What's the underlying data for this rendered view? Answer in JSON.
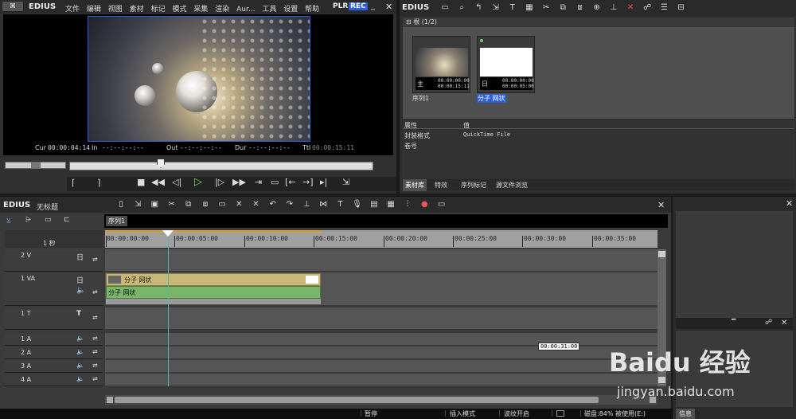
{
  "player": {
    "brand": "EDIUS",
    "menu": [
      "文件",
      "编辑",
      "视图",
      "素材",
      "标记",
      "模式",
      "采集",
      "渲染",
      "Aur...",
      "工具",
      "设置",
      "帮助"
    ],
    "mode_plr": "PLR",
    "mode_rec": "REC",
    "cur_label": "Cur",
    "cur_value": "00:00:04:14",
    "in_label": "In",
    "in_value": "--:--:--:--",
    "out_label": "Out",
    "out_value": "--:--:--:--",
    "dur_label": "Dur",
    "dur_value": "--:--:--:--",
    "ttl_label": "Ttl",
    "ttl_value": "00:00:15:11"
  },
  "bin": {
    "brand": "EDIUS",
    "folder_label": "根 (1/2)",
    "clips": [
      {
        "name": "序列1",
        "badge": "主",
        "tc1": "00:00:00:00",
        "tc2": "00:00:15:11"
      },
      {
        "name": "分子 网状",
        "badge": "日",
        "tc1": "00:00:00:00",
        "tc2": "00:00:05:00"
      }
    ],
    "prop_header_key": "属性",
    "prop_header_val": "值",
    "props": [
      {
        "key": "封装格式",
        "val": "QuickTime File"
      },
      {
        "key": "卷号",
        "val": ""
      }
    ],
    "tabs": [
      "素材库",
      "特效",
      "序列标记",
      "源文件浏览"
    ]
  },
  "timeline": {
    "brand": "EDIUS",
    "project_title": "无标题",
    "sequence_tab": "序列1",
    "scale_label": "1 秒",
    "ruler": [
      "00:00:00:00",
      "00:00:05:00",
      "00:00:10:00",
      "00:00:15:00",
      "00:00:20:00",
      "00:00:25:00",
      "00:00:30:00",
      "00:00:35:00"
    ],
    "tracks": [
      {
        "name": "2 V",
        "type_icon": "日"
      },
      {
        "name": "1 VA",
        "type_icon": "日"
      },
      {
        "name": "1 T",
        "type_icon": "T"
      },
      {
        "name": "1 A"
      },
      {
        "name": "2 A"
      },
      {
        "name": "3 A"
      },
      {
        "name": "4 A"
      }
    ],
    "clip_video_label": "分子 网状",
    "clip_audio_label": "分子 网状",
    "tooltip_tc": "00:00:31:00"
  },
  "status": {
    "pause": "暂停",
    "insert_mode": "插入模式",
    "ripple": "波纹开启",
    "disk": "磁盘:84% 被使用(E:)"
  },
  "info_panel": {
    "tab": "信息"
  },
  "watermark": {
    "brand": "Baidu 经验",
    "url": "jingyan.baidu.com"
  },
  "colors": {
    "accent_blue": "#2b5fd9",
    "clip_video": "#c8b878",
    "clip_audio": "#7ab66a",
    "playhead": "#4fb8b0"
  }
}
